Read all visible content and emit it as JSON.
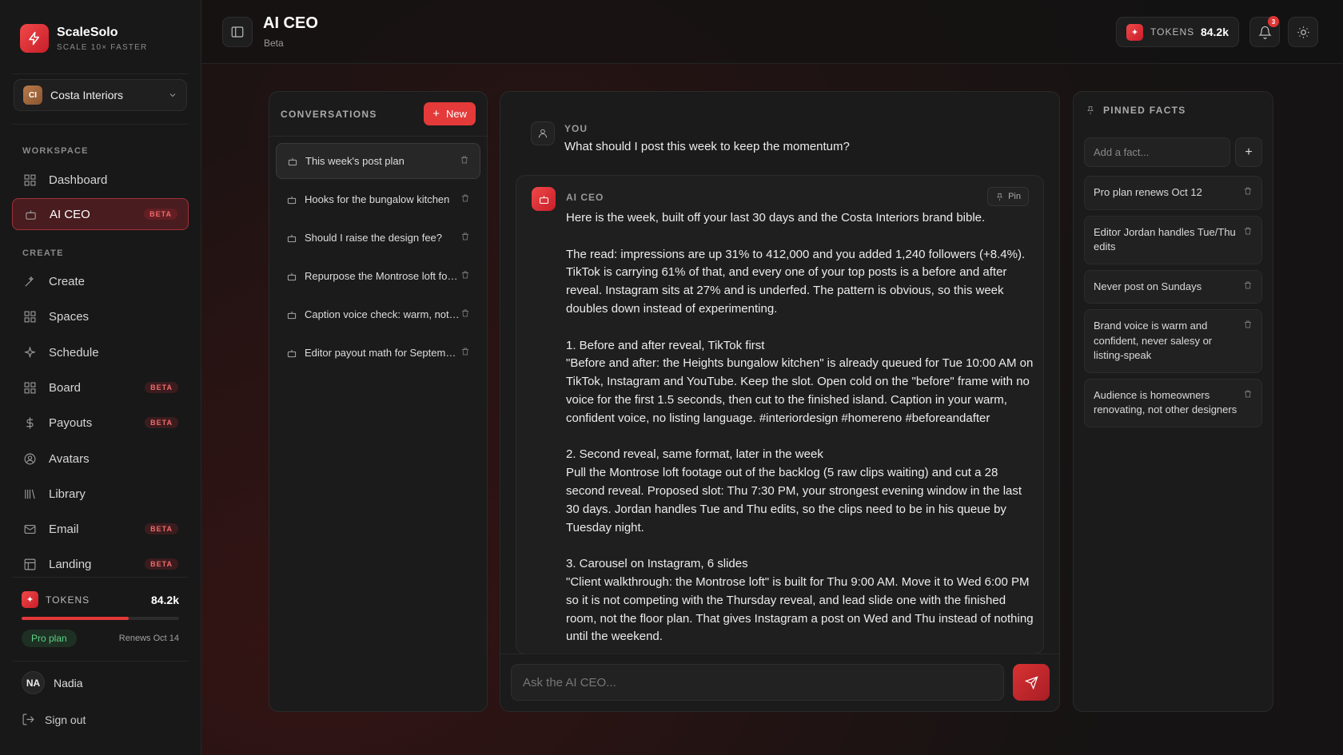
{
  "brand": {
    "name": "ScaleSolo",
    "tagline": "SCALE 10× FASTER"
  },
  "workspace_switcher": {
    "initials": "CI",
    "name": "Costa Interiors"
  },
  "sidebar": {
    "workspace_label": "WORKSPACE",
    "create_label": "CREATE",
    "items": [
      {
        "label": "Dashboard",
        "icon": "grid-icon",
        "badge": ""
      },
      {
        "label": "AI CEO",
        "icon": "robot-icon",
        "badge": "BETA",
        "active": true
      },
      {
        "label": "Create",
        "icon": "wand-icon",
        "badge": ""
      },
      {
        "label": "Spaces",
        "icon": "grid-icon",
        "badge": ""
      },
      {
        "label": "Schedule",
        "icon": "sparkle-icon",
        "badge": ""
      },
      {
        "label": "Board",
        "icon": "grid-icon",
        "badge": "BETA"
      },
      {
        "label": "Payouts",
        "icon": "dollar-icon",
        "badge": "BETA"
      },
      {
        "label": "Avatars",
        "icon": "user-circle-icon",
        "badge": ""
      },
      {
        "label": "Library",
        "icon": "library-icon",
        "badge": ""
      },
      {
        "label": "Email",
        "icon": "mail-icon",
        "badge": "BETA"
      },
      {
        "label": "Landing",
        "icon": "layout-icon",
        "badge": "BETA"
      }
    ],
    "tokens": {
      "label": "TOKENS",
      "value": "84.2k",
      "usage_fraction": 0.68
    },
    "plan": {
      "label": "Pro plan",
      "renews": "Renews Oct 14"
    },
    "user": {
      "initials": "NA",
      "name": "Nadia"
    },
    "sign_out": "Sign out"
  },
  "header": {
    "title": "AI CEO",
    "subtitle": "Beta",
    "tokens_label": "TOKENS",
    "tokens_value": "84.2k",
    "notification_count": "3"
  },
  "conversations": {
    "title": "CONVERSATIONS",
    "new_label": "New",
    "items": [
      {
        "label": "This week's post plan",
        "active": true
      },
      {
        "label": "Hooks for the bungalow kitchen"
      },
      {
        "label": "Should I raise the design fee?"
      },
      {
        "label": "Repurpose the Montrose loft footage"
      },
      {
        "label": "Caption voice check: warm, not salesy"
      },
      {
        "label": "Editor payout math for September"
      }
    ]
  },
  "chat": {
    "user_role": "YOU",
    "user_message": "What should I post this week to keep the momentum?",
    "ai_role": "AI CEO",
    "pin_label": "Pin",
    "ai_message": "Here is the week, built off your last 30 days and the Costa Interiors brand bible.\n\nThe read: impressions are up 31% to 412,000 and you added 1,240 followers (+8.4%). TikTok is carrying 61% of that, and every one of your top posts is a before and after reveal. Instagram sits at 27% and is underfed. The pattern is obvious, so this week doubles down instead of experimenting.\n\n1. Before and after reveal, TikTok first\n\"Before and after: the Heights bungalow kitchen\" is already queued for Tue 10:00 AM on TikTok, Instagram and YouTube. Keep the slot. Open cold on the \"before\" frame with no voice for the first 1.5 seconds, then cut to the finished island. Caption in your warm, confident voice, no listing language. #interiordesign #homereno #beforeandafter\n\n2. Second reveal, same format, later in the week\nPull the Montrose loft footage out of the backlog (5 raw clips waiting) and cut a 28 second reveal. Proposed slot: Thu 7:30 PM, your strongest evening window in the last 30 days. Jordan handles Tue and Thu edits, so the clips need to be in his queue by Tuesday night.\n\n3. Carousel on Instagram, 6 slides\n\"Client walkthrough: the Montrose loft\" is built for Thu 9:00 AM. Move it to Wed 6:00 PM so it is not competing with the Thursday reveal, and lead slide one with the finished room, not the floor plan. That gives Instagram a post on Wed and Thu instead of nothing until the weekend.",
    "input_placeholder": "Ask the AI CEO..."
  },
  "pinned_facts": {
    "title": "PINNED FACTS",
    "input_placeholder": "Add a fact...",
    "items": [
      "Pro plan renews Oct 12",
      "Editor Jordan handles Tue/Thu edits",
      "Never post on Sundays",
      "Brand voice is warm and confident, never salesy or listing-speak",
      "Audience is homeowners renovating, not other designers"
    ]
  },
  "colors": {
    "accent": "#e43a3a",
    "success": "#5fd089",
    "bg": "#141414"
  }
}
